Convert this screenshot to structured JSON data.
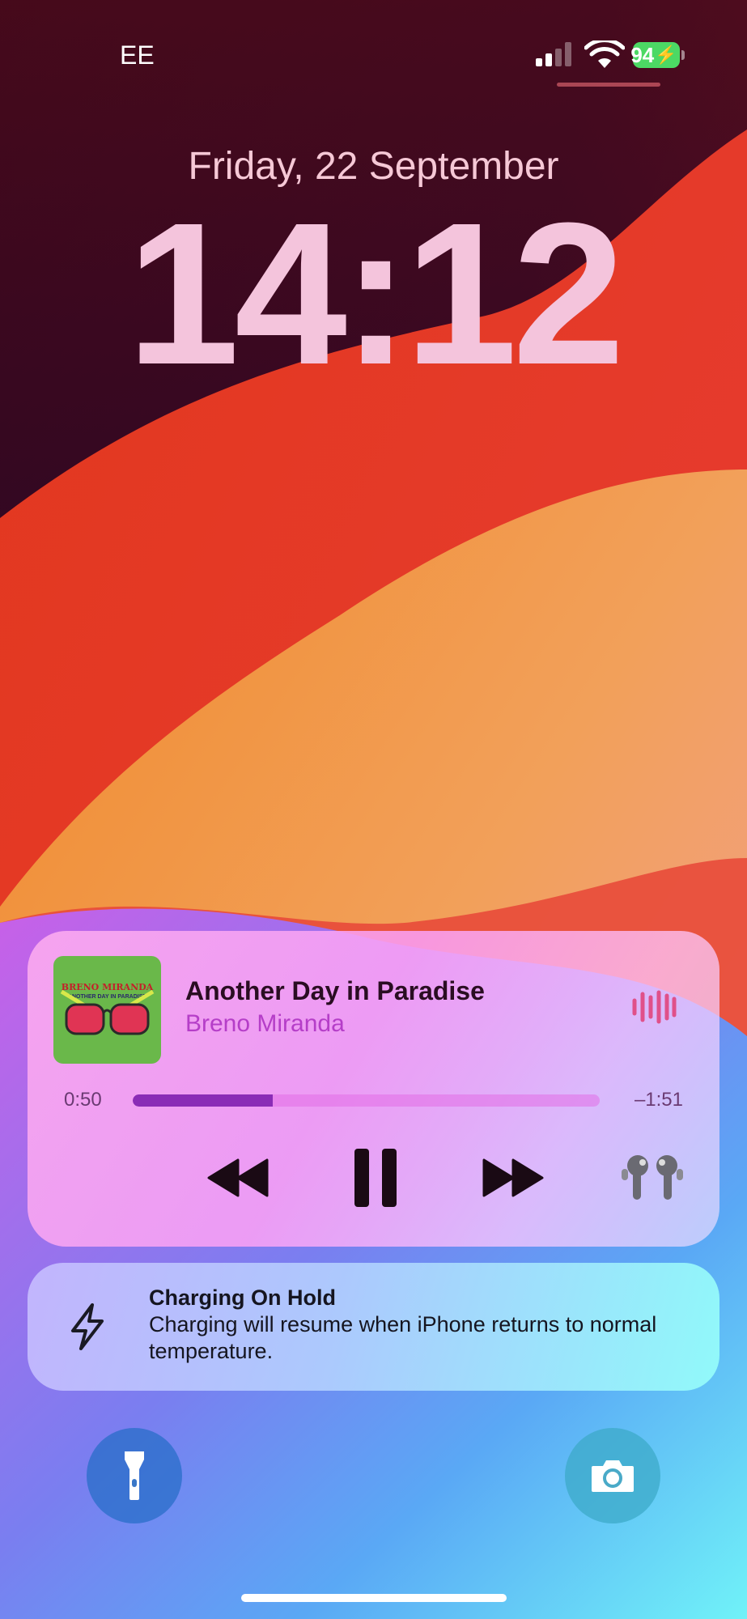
{
  "status_bar": {
    "carrier": "EE",
    "battery_percent": "94",
    "battery_charging": true,
    "signal_bars": 2,
    "signal_bars_total": 4
  },
  "lock_screen": {
    "date": "Friday, 22 September",
    "time": "14:12"
  },
  "now_playing": {
    "track_title": "Another Day in Paradise",
    "artist": "Breno Miranda",
    "album_art_text": "BRENO MIRANDA",
    "album_art_subtext": "ANOTHER DAY IN PARADISE",
    "elapsed": "0:50",
    "remaining": "–1:51",
    "progress_fraction": 0.3,
    "controls": [
      "rewind-icon",
      "pause-icon",
      "fast-forward-icon",
      "airpods-icon"
    ],
    "accent_color": "#b53ec8"
  },
  "notification": {
    "title": "Charging On Hold",
    "body": "Charging will resume when iPhone returns to normal temperature.",
    "icon": "lightning-bolt-icon"
  },
  "quick_actions": {
    "left": "flashlight-icon",
    "right": "camera-icon"
  }
}
